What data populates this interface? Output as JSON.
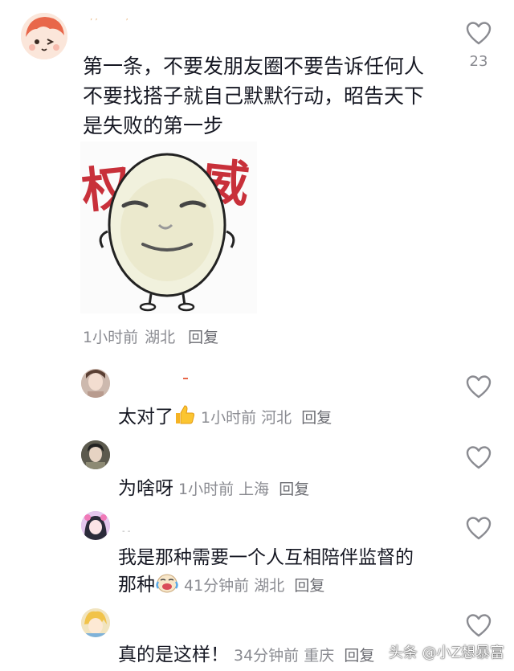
{
  "main_comment": {
    "text": "第一条，不要发朋友圈不要告诉任何人不要找搭子就自己默默行动，昭告天下是失败的第一步",
    "sticker_text_left": "权",
    "sticker_text_right": "威",
    "time": "1小时前",
    "location": "湖北",
    "reply_label": "回复",
    "like_count": "23"
  },
  "replies": [
    {
      "text": "太对了",
      "emoji": "thumbs-up",
      "time": "1小时前",
      "location": "河北",
      "reply_label": "回复"
    },
    {
      "text": "为啥呀",
      "time": "1小时前",
      "location": "上海",
      "reply_label": "回复"
    },
    {
      "text_line1": "我是那种需要一个人互相陪伴监督的",
      "text_line2": "那种",
      "emoji": "crying-laughing",
      "time": "41分钟前",
      "location": "湖北",
      "reply_label": "回复"
    },
    {
      "text": "真的是这样！",
      "time": "34分钟前",
      "location": "重庆",
      "reply_label": "回复"
    }
  ],
  "watermark": "头条 @小Z想暴富",
  "colors": {
    "text": "#161823",
    "meta": "#8a8b91",
    "sticker_red": "#c8303a"
  }
}
